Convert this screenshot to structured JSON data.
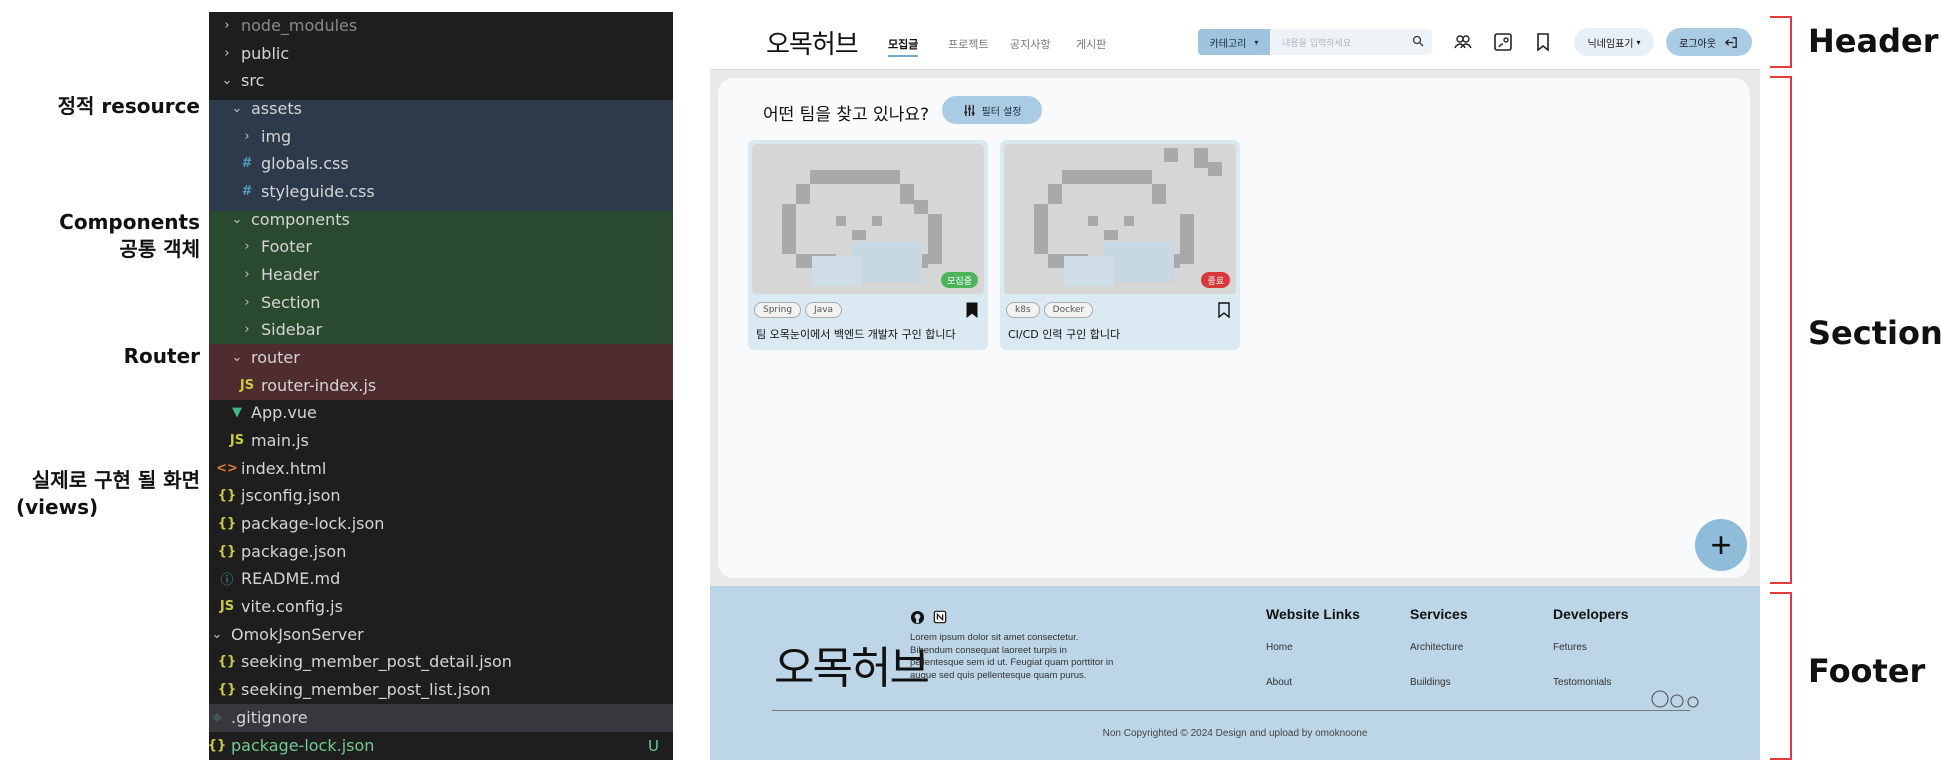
{
  "annotations_left": {
    "static_resource": "정적 resource",
    "components_line1": "Components",
    "components_line2": "공통 객체",
    "router": "Router",
    "views_line1": "실제로 구현 될 화면",
    "views_line2": "(views)"
  },
  "annotations_right": {
    "header": "Header",
    "section": "Section",
    "footer": "Footer"
  },
  "explorer": {
    "items": [
      {
        "label": "node_modules",
        "type": "folder",
        "open": false
      },
      {
        "label": "public",
        "type": "folder",
        "open": false
      },
      {
        "label": "src",
        "type": "folder",
        "open": true
      },
      {
        "label": "assets",
        "type": "folder",
        "open": true
      },
      {
        "label": "img",
        "type": "folder",
        "open": false
      },
      {
        "label": "globals.css",
        "type": "css"
      },
      {
        "label": "styleguide.css",
        "type": "css"
      },
      {
        "label": "components",
        "type": "folder",
        "open": true
      },
      {
        "label": "Footer",
        "type": "folder",
        "open": false
      },
      {
        "label": "Header",
        "type": "folder",
        "open": false
      },
      {
        "label": "Section",
        "type": "folder",
        "open": false
      },
      {
        "label": "Sidebar",
        "type": "folder",
        "open": false
      },
      {
        "label": "router",
        "type": "folder",
        "open": true
      },
      {
        "label": "router-index.js",
        "type": "js"
      },
      {
        "label": "App.vue",
        "type": "vue"
      },
      {
        "label": "main.js",
        "type": "js"
      },
      {
        "label": "index.html",
        "type": "html"
      },
      {
        "label": "jsconfig.json",
        "type": "json"
      },
      {
        "label": "package-lock.json",
        "type": "json"
      },
      {
        "label": "package.json",
        "type": "json"
      },
      {
        "label": "README.md",
        "type": "info"
      },
      {
        "label": "vite.config.js",
        "type": "js"
      },
      {
        "label": "OmokJsonServer",
        "type": "folder",
        "open": true
      },
      {
        "label": "seeking_member_post_detail.json",
        "type": "json"
      },
      {
        "label": "seeking_member_post_list.json",
        "type": "json"
      },
      {
        "label": ".gitignore",
        "type": "git"
      },
      {
        "label": "package-lock.json",
        "type": "json",
        "status": "U"
      }
    ]
  },
  "app": {
    "logo": "오목허브",
    "nav": [
      "모집글",
      "프로젝트",
      "공지사항",
      "게시판"
    ],
    "category_label": "카테고리",
    "search_placeholder": "내용을 입력하세요",
    "nickname_label": "닉네임표기",
    "logout_label": "로그아웃",
    "section_question": "어떤 팀을 찾고 있나요?",
    "filter_label": "필터 설정",
    "cards": [
      {
        "status": "모집중",
        "status_color": "#4cb35b",
        "tags": [
          "Spring",
          "Java"
        ],
        "bookmarked": true,
        "title": "팀 오목눈이에서 백엔드 개발자 구인 합니다"
      },
      {
        "status": "종료",
        "status_color": "#d83a3a",
        "tags": [
          "k8s",
          "Docker"
        ],
        "bookmarked": false,
        "title": "CI/CD 인력 구인 합니다"
      }
    ],
    "fab_symbol": "+"
  },
  "footer": {
    "logo": "오목허브",
    "description": "Lorem ipsum dolor sit amet consectetur. Bibendum consequat laoreet turpis in pellentesque sem id ut. Feugiat quam porttitor in augue sed quis pellentesque quam purus.",
    "columns": [
      {
        "title": "Website Links",
        "links": [
          "Home",
          "About"
        ]
      },
      {
        "title": "Services",
        "links": [
          "Architecture",
          "Buildings"
        ]
      },
      {
        "title": "Developers",
        "links": [
          "Fetures",
          "Testomonials"
        ]
      }
    ],
    "copyright": "Non Copyrighted © 2024 Design and upload by omoknoone"
  }
}
